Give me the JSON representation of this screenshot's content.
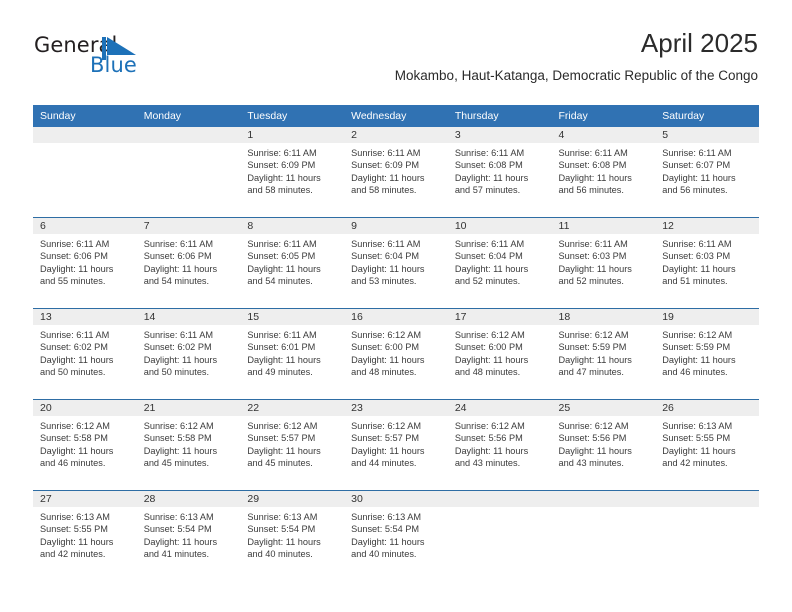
{
  "brand": {
    "name_part1": "General",
    "name_part2": "Blue",
    "accent_color": "#1d71b8",
    "logo_icon": "triangle-flag-icon"
  },
  "header": {
    "month_title": "April 2025",
    "location": "Mokambo, Haut-Katanga, Democratic Republic of the Congo"
  },
  "calendar": {
    "header_color": "#3072B3",
    "daynum_band_color": "#eeeeee",
    "weekday_headers": [
      "Sunday",
      "Monday",
      "Tuesday",
      "Wednesday",
      "Thursday",
      "Friday",
      "Saturday"
    ],
    "weeks": [
      [
        {
          "day": "",
          "lines": []
        },
        {
          "day": "",
          "lines": []
        },
        {
          "day": "1",
          "lines": [
            "Sunrise: 6:11 AM",
            "Sunset: 6:09 PM",
            "Daylight: 11 hours",
            "and 58 minutes."
          ]
        },
        {
          "day": "2",
          "lines": [
            "Sunrise: 6:11 AM",
            "Sunset: 6:09 PM",
            "Daylight: 11 hours",
            "and 58 minutes."
          ]
        },
        {
          "day": "3",
          "lines": [
            "Sunrise: 6:11 AM",
            "Sunset: 6:08 PM",
            "Daylight: 11 hours",
            "and 57 minutes."
          ]
        },
        {
          "day": "4",
          "lines": [
            "Sunrise: 6:11 AM",
            "Sunset: 6:08 PM",
            "Daylight: 11 hours",
            "and 56 minutes."
          ]
        },
        {
          "day": "5",
          "lines": [
            "Sunrise: 6:11 AM",
            "Sunset: 6:07 PM",
            "Daylight: 11 hours",
            "and 56 minutes."
          ]
        }
      ],
      [
        {
          "day": "6",
          "lines": [
            "Sunrise: 6:11 AM",
            "Sunset: 6:06 PM",
            "Daylight: 11 hours",
            "and 55 minutes."
          ]
        },
        {
          "day": "7",
          "lines": [
            "Sunrise: 6:11 AM",
            "Sunset: 6:06 PM",
            "Daylight: 11 hours",
            "and 54 minutes."
          ]
        },
        {
          "day": "8",
          "lines": [
            "Sunrise: 6:11 AM",
            "Sunset: 6:05 PM",
            "Daylight: 11 hours",
            "and 54 minutes."
          ]
        },
        {
          "day": "9",
          "lines": [
            "Sunrise: 6:11 AM",
            "Sunset: 6:04 PM",
            "Daylight: 11 hours",
            "and 53 minutes."
          ]
        },
        {
          "day": "10",
          "lines": [
            "Sunrise: 6:11 AM",
            "Sunset: 6:04 PM",
            "Daylight: 11 hours",
            "and 52 minutes."
          ]
        },
        {
          "day": "11",
          "lines": [
            "Sunrise: 6:11 AM",
            "Sunset: 6:03 PM",
            "Daylight: 11 hours",
            "and 52 minutes."
          ]
        },
        {
          "day": "12",
          "lines": [
            "Sunrise: 6:11 AM",
            "Sunset: 6:03 PM",
            "Daylight: 11 hours",
            "and 51 minutes."
          ]
        }
      ],
      [
        {
          "day": "13",
          "lines": [
            "Sunrise: 6:11 AM",
            "Sunset: 6:02 PM",
            "Daylight: 11 hours",
            "and 50 minutes."
          ]
        },
        {
          "day": "14",
          "lines": [
            "Sunrise: 6:11 AM",
            "Sunset: 6:02 PM",
            "Daylight: 11 hours",
            "and 50 minutes."
          ]
        },
        {
          "day": "15",
          "lines": [
            "Sunrise: 6:11 AM",
            "Sunset: 6:01 PM",
            "Daylight: 11 hours",
            "and 49 minutes."
          ]
        },
        {
          "day": "16",
          "lines": [
            "Sunrise: 6:12 AM",
            "Sunset: 6:00 PM",
            "Daylight: 11 hours",
            "and 48 minutes."
          ]
        },
        {
          "day": "17",
          "lines": [
            "Sunrise: 6:12 AM",
            "Sunset: 6:00 PM",
            "Daylight: 11 hours",
            "and 48 minutes."
          ]
        },
        {
          "day": "18",
          "lines": [
            "Sunrise: 6:12 AM",
            "Sunset: 5:59 PM",
            "Daylight: 11 hours",
            "and 47 minutes."
          ]
        },
        {
          "day": "19",
          "lines": [
            "Sunrise: 6:12 AM",
            "Sunset: 5:59 PM",
            "Daylight: 11 hours",
            "and 46 minutes."
          ]
        }
      ],
      [
        {
          "day": "20",
          "lines": [
            "Sunrise: 6:12 AM",
            "Sunset: 5:58 PM",
            "Daylight: 11 hours",
            "and 46 minutes."
          ]
        },
        {
          "day": "21",
          "lines": [
            "Sunrise: 6:12 AM",
            "Sunset: 5:58 PM",
            "Daylight: 11 hours",
            "and 45 minutes."
          ]
        },
        {
          "day": "22",
          "lines": [
            "Sunrise: 6:12 AM",
            "Sunset: 5:57 PM",
            "Daylight: 11 hours",
            "and 45 minutes."
          ]
        },
        {
          "day": "23",
          "lines": [
            "Sunrise: 6:12 AM",
            "Sunset: 5:57 PM",
            "Daylight: 11 hours",
            "and 44 minutes."
          ]
        },
        {
          "day": "24",
          "lines": [
            "Sunrise: 6:12 AM",
            "Sunset: 5:56 PM",
            "Daylight: 11 hours",
            "and 43 minutes."
          ]
        },
        {
          "day": "25",
          "lines": [
            "Sunrise: 6:12 AM",
            "Sunset: 5:56 PM",
            "Daylight: 11 hours",
            "and 43 minutes."
          ]
        },
        {
          "day": "26",
          "lines": [
            "Sunrise: 6:13 AM",
            "Sunset: 5:55 PM",
            "Daylight: 11 hours",
            "and 42 minutes."
          ]
        }
      ],
      [
        {
          "day": "27",
          "lines": [
            "Sunrise: 6:13 AM",
            "Sunset: 5:55 PM",
            "Daylight: 11 hours",
            "and 42 minutes."
          ]
        },
        {
          "day": "28",
          "lines": [
            "Sunrise: 6:13 AM",
            "Sunset: 5:54 PM",
            "Daylight: 11 hours",
            "and 41 minutes."
          ]
        },
        {
          "day": "29",
          "lines": [
            "Sunrise: 6:13 AM",
            "Sunset: 5:54 PM",
            "Daylight: 11 hours",
            "and 40 minutes."
          ]
        },
        {
          "day": "30",
          "lines": [
            "Sunrise: 6:13 AM",
            "Sunset: 5:54 PM",
            "Daylight: 11 hours",
            "and 40 minutes."
          ]
        },
        {
          "day": "",
          "lines": []
        },
        {
          "day": "",
          "lines": []
        },
        {
          "day": "",
          "lines": []
        }
      ]
    ]
  }
}
